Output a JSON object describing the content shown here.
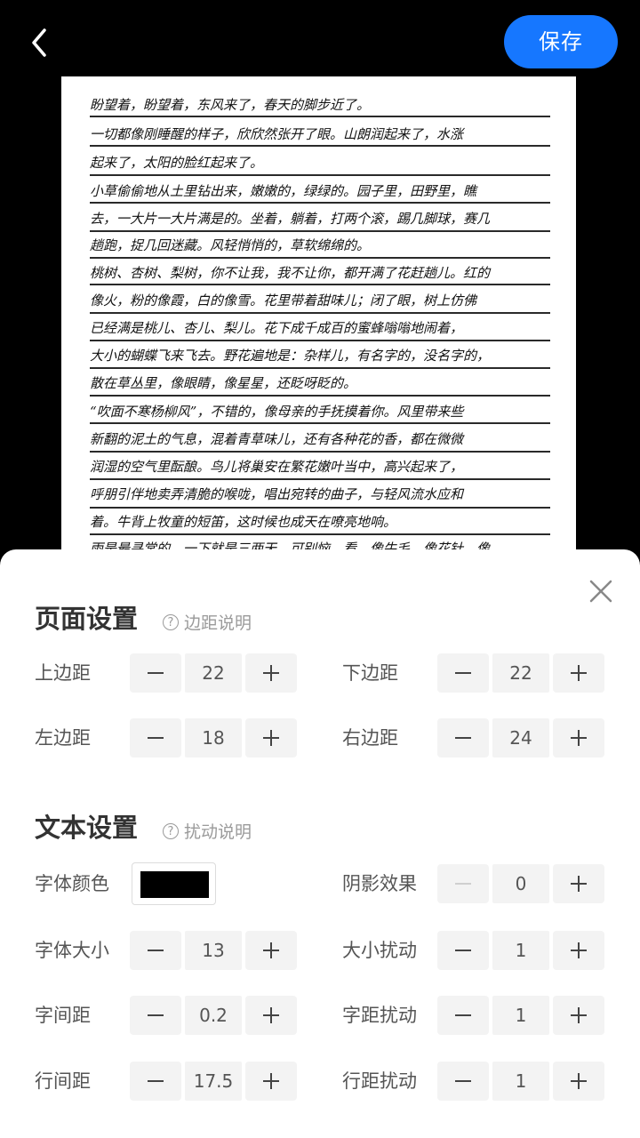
{
  "header": {
    "save_label": "保存"
  },
  "paper": {
    "lines": [
      "盼望着，盼望着，东风来了，春天的脚步近了。",
      "一切都像刚睡醒的样子，欣欣然张开了眼。山朗润起来了，水涨",
      "起来了，太阳的脸红起来了。",
      "小草偷偷地从土里钻出来，嫩嫩的，绿绿的。园子里，田野里，瞧",
      "去，一大片一大片满是的。坐着，躺着，打两个滚，踢几脚球，赛几",
      "趟跑，捉几回迷藏。风轻悄悄的，草软绵绵的。",
      "桃树、杏树、梨树，你不让我，我不让你，都开满了花赶趟儿。红的",
      "像火，粉的像霞，白的像雪。花里带着甜味儿；闭了眼，树上仿佛",
      "已经满是桃儿、杏儿、梨儿。花下成千成百的蜜蜂嗡嗡地闹着，",
      "大小的蝴蝶飞来飞去。野花遍地是：杂样儿，有名字的，没名字的，",
      "散在草丛里，像眼睛，像星星，还眨呀眨的。",
      "“吹面不寒杨柳风”，不错的，像母亲的手抚摸着你。风里带来些",
      "新翻的泥土的气息，混着青草味儿，还有各种花的香，都在微微",
      "润湿的空气里酝酿。鸟儿将巢安在繁花嫩叶当中，高兴起来了，",
      "呼朋引伴地卖弄清脆的喉咙，唱出宛转的曲子，与轻风流水应和",
      "着。牛背上牧童的短笛，这时候也成天在嘹亮地响。",
      "雨是最寻常的，一下就是三两天。可别恼。看，像牛毛，像花针，像"
    ]
  },
  "sheet": {
    "page_settings": {
      "title": "页面设置",
      "help_label": "边距说明",
      "fields": {
        "top_margin": {
          "label": "上边距",
          "value": "22"
        },
        "bottom_margin": {
          "label": "下边距",
          "value": "22"
        },
        "left_margin": {
          "label": "左边距",
          "value": "18"
        },
        "right_margin": {
          "label": "右边距",
          "value": "24"
        }
      }
    },
    "text_settings": {
      "title": "文本设置",
      "help_label": "扰动说明",
      "fields": {
        "font_color": {
          "label": "字体颜色",
          "value": "#000000"
        },
        "shadow": {
          "label": "阴影效果",
          "value": "0"
        },
        "font_size": {
          "label": "字体大小",
          "value": "13"
        },
        "size_jitter": {
          "label": "大小扰动",
          "value": "1"
        },
        "letter_spacing": {
          "label": "字间距",
          "value": "0.2"
        },
        "spacing_jitter": {
          "label": "字距扰动",
          "value": "1"
        },
        "line_spacing": {
          "label": "行间距",
          "value": "17.5"
        },
        "line_jitter": {
          "label": "行距扰动",
          "value": "1"
        }
      }
    }
  },
  "colors": {
    "accent": "#1677ff",
    "background": "#000000",
    "sheet": "#ffffff"
  },
  "icons": {
    "back": "chevron-left-icon",
    "close": "close-icon",
    "help": "question-circle-icon"
  }
}
